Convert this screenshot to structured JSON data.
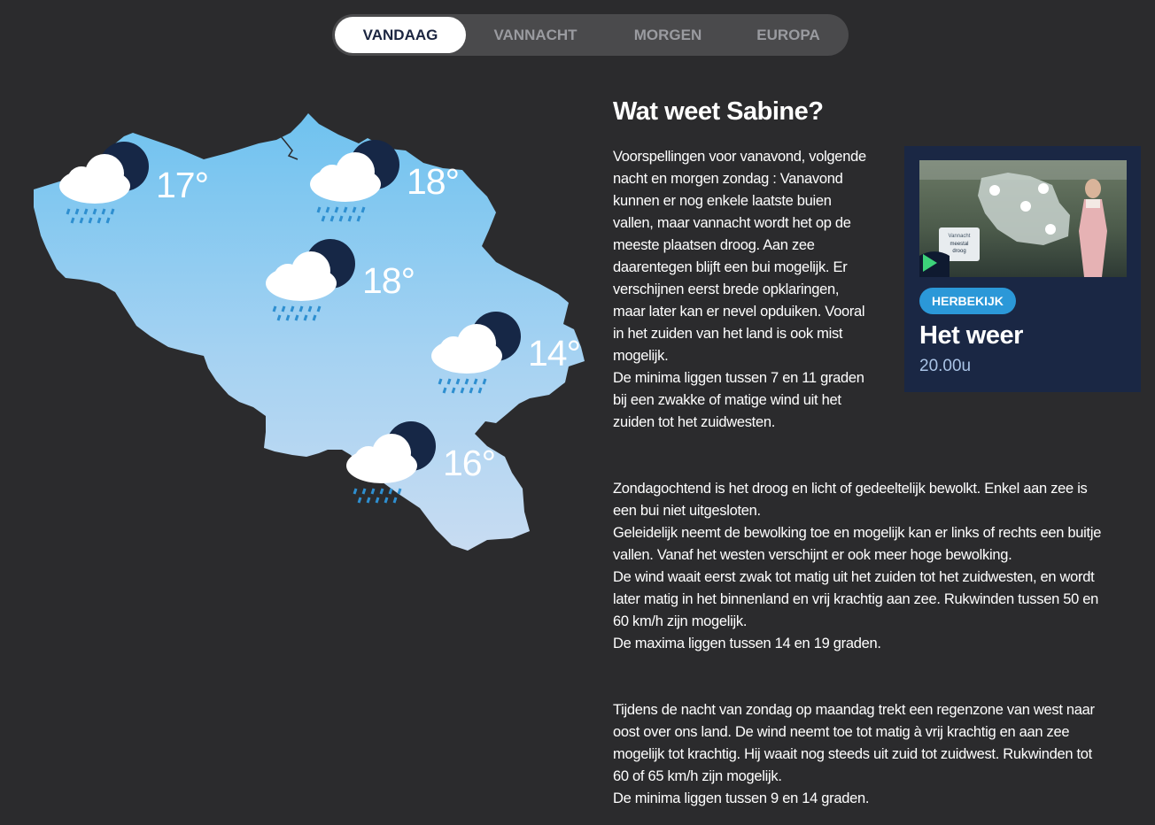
{
  "tabs": [
    "VANDAAG",
    "VANNACHT",
    "MORGEN",
    "EUROPA"
  ],
  "active_tab": 0,
  "map": {
    "forecasts": [
      {
        "temp": "17°",
        "icon": "rain-cloud-moon-icon"
      },
      {
        "temp": "18°",
        "icon": "rain-cloud-moon-icon"
      },
      {
        "temp": "18°",
        "icon": "rain-cloud-moon-icon"
      },
      {
        "temp": "14°",
        "icon": "rain-cloud-moon-icon"
      },
      {
        "temp": "16°",
        "icon": "rain-cloud-moon-icon"
      }
    ]
  },
  "article": {
    "title": "Wat weet Sabine?",
    "p1_lines": [
      "Voorspellingen voor vanavond, volgende",
      "nacht en morgen zondag : Vanavond",
      "kunnen er nog enkele laatste buien",
      "vallen, maar vannacht wordt het op de",
      "meeste plaatsen droog. Aan zee",
      "daarentegen blijft een bui mogelijk. Er",
      "verschijnen eerst brede opklaringen,",
      "maar later kan er nevel opduiken. Vooral",
      "in het zuiden van het land is ook mist",
      "mogelijk.",
      "De minima liggen tussen 7 en 11 graden",
      "bij een zwakke of matige wind uit het",
      "zuiden tot het zuidwesten."
    ],
    "p2_lines": [
      "Zondagochtend is het droog en licht of gedeeltelijk bewolkt. Enkel aan zee is",
      "een bui niet uitgesloten.",
      "Geleidelijk neemt de bewolking toe en mogelijk kan er links of rechts een buitje",
      "vallen. Vanaf het westen verschijnt er ook meer hoge bewolking.",
      "De wind waait eerst zwak tot matig uit het zuiden tot het zuidwesten, en wordt",
      "later matig in het binnenland en vrij krachtig aan zee. Rukwinden tussen 50 en",
      "60 km/h zijn mogelijk.",
      "De maxima liggen tussen 14 en 19 graden."
    ],
    "p3_lines": [
      "Tijdens de nacht van zondag op maandag trekt een regenzone van west naar",
      "oost over ons land. De wind neemt toe tot matig à vrij krachtig en aan zee",
      "mogelijk tot krachtig. Hij waait nog steeds uit zuid tot zuidwest. Rukwinden tot",
      "60 of 65 km/h zijn mogelijk.",
      "De minima liggen tussen 9 en 14 graden."
    ]
  },
  "video": {
    "badge": "HERBEKIJK",
    "title": "Het weer",
    "time": "20.00u",
    "thumb_caption_1": "Vannacht",
    "thumb_caption_2": "meestal",
    "thumb_caption_3": "droog",
    "play_icon": "play-icon"
  },
  "colors": {
    "background": "#2b2b2d",
    "map_top": "#7cc8f0",
    "map_bottom": "#c6dbf2",
    "card": "#1a2744",
    "badge": "#2b98d8",
    "play": "#3dd37a"
  }
}
